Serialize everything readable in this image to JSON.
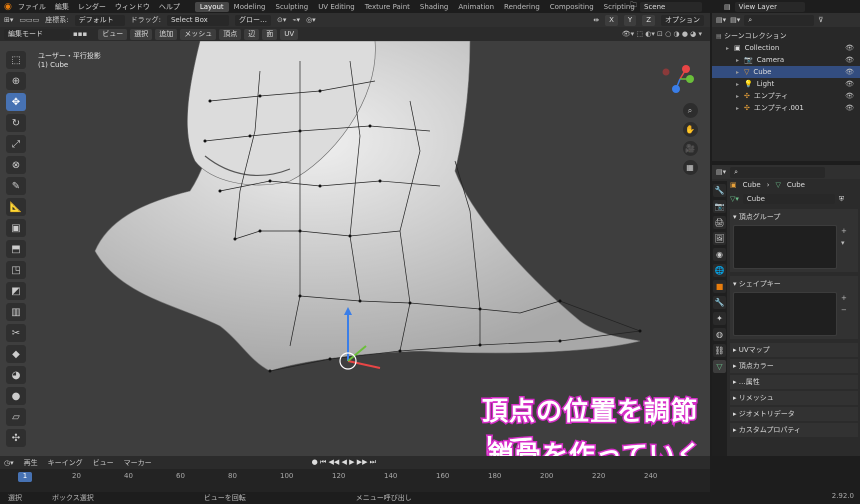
{
  "menu": [
    "ファイル",
    "編集",
    "レンダー",
    "ウィンドウ",
    "ヘルプ"
  ],
  "workspaces": [
    "Layout",
    "Modeling",
    "Sculpting",
    "UV Editing",
    "Texture Paint",
    "Shading",
    "Animation",
    "Rendering",
    "Compositing",
    "Scripting"
  ],
  "active_workspace": "Layout",
  "scene_name": "Scene",
  "view_layer": "View Layer",
  "header": {
    "coord_label": "座標系:",
    "coord_value": "デフォルト",
    "drag_label": "ドラッグ:",
    "drag_value": "Select Box",
    "orientation": "グロー…",
    "axes": [
      "X",
      "Y",
      "Z"
    ],
    "options": "オプション"
  },
  "header2": {
    "mode": "編集モード",
    "menus": [
      "ビュー",
      "選択",
      "追加",
      "メッシュ",
      "頂点",
      "辺",
      "面",
      "UV"
    ]
  },
  "viewport": {
    "view_name": "ユーザー・平行投影",
    "object_name": "(1) Cube"
  },
  "overlay_text": [
    "頂点の位置を調節して",
    "鎖骨を作っていく"
  ],
  "outliner": {
    "title": "シーンコレクション",
    "items": [
      {
        "label": "Collection",
        "depth": 1,
        "icon": "collection-icon"
      },
      {
        "label": "Camera",
        "depth": 2,
        "icon": "camera-icon"
      },
      {
        "label": "Cube",
        "depth": 2,
        "icon": "mesh-icon",
        "selected": true
      },
      {
        "label": "Light",
        "depth": 2,
        "icon": "light-icon"
      },
      {
        "label": "エンプティ",
        "depth": 2,
        "icon": "empty-icon"
      },
      {
        "label": "エンプティ.001",
        "depth": 2,
        "icon": "empty-icon"
      }
    ]
  },
  "properties": {
    "object": "Cube",
    "mesh": "Cube",
    "data_name": "Cube",
    "panels": [
      "頂点グループ",
      "シェイプキー"
    ],
    "collapsed": [
      "UVマップ",
      "頂点カラー",
      "…属性",
      "リメッシュ",
      "ジオメトリデータ",
      "カスタムプロパティ"
    ]
  },
  "timeline": {
    "menus": [
      "再生",
      "キーイング",
      "ビュー",
      "マーカー"
    ],
    "ticks": [
      "1",
      "20",
      "40",
      "60",
      "80",
      "100",
      "120",
      "140",
      "160",
      "180",
      "200",
      "220",
      "240"
    ],
    "current_frame": "1"
  },
  "status": {
    "items": [
      "選択",
      "ボックス選択",
      "ビューを回転",
      "メニュー呼び出し"
    ],
    "version": "2.92.0"
  }
}
